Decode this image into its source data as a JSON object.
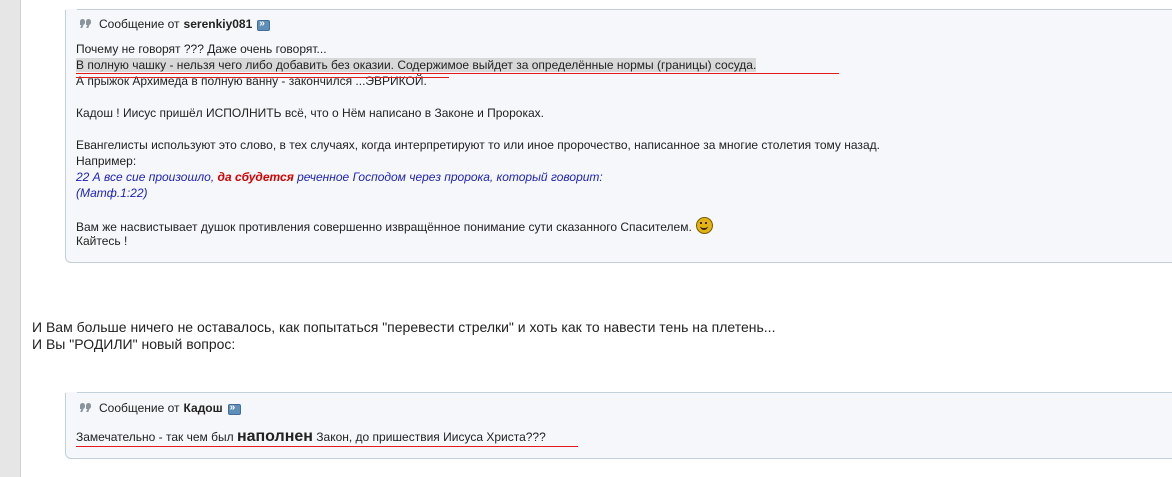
{
  "quote1": {
    "header_prefix": "Сообщение от",
    "author": "serenkiy081",
    "lines": [
      "Почему не говорят ??? Даже очень говорят...",
      "В полную чашку - нельзя чего либо добавить без оказии. Содержимое выйдет за определённые нормы (границы) сосуда.",
      "А прыжок Архимеда в полную ванну - закончился ...ЭВРИКОЙ.",
      "Кадош ! Иисус пришёл ИСПОЛНИТЬ всё, что о Нём написано в Законе и Пророках.",
      "Евангелисты используют это слово, в тех случаях, когда интерпретируют то или иное пророчество, написанное за многие столетия тому назад.",
      "Например:"
    ],
    "verse_before": "22 А все сие произошло, ",
    "verse_emph": "да сбудется",
    "verse_after": " реченное Господом через пророка, который говорит:",
    "verse_ref": "(Матф.1:22)",
    "tail_line1": "Вам же насвистывает душок противления совершенно извращённое понимание сути сказанного Спасителем.",
    "tail_line2": "Кайтесь !",
    "smiley_icon": "smiley-icon"
  },
  "body_text": {
    "line1": "И Вам больше ничего не оставалось, как попытаться \"перевести стрелки\" и хоть как то навести тень на плетень...",
    "line2": "И Вы \"РОДИЛИ\" новый вопрос:"
  },
  "quote2": {
    "header_prefix": "Сообщение от",
    "author": "Кадош",
    "text_before": "Замечательно - так чем был ",
    "text_emph": "наполнен",
    "text_after": " Закон, до пришествия Иисуса Христа???"
  },
  "colors": {
    "underline": "#e41b1b",
    "verse_blue": "#1e22b8",
    "verse_red": "#d40000",
    "quote_bg": "#f5f7fa",
    "quote_border": "#c3cfdb"
  }
}
